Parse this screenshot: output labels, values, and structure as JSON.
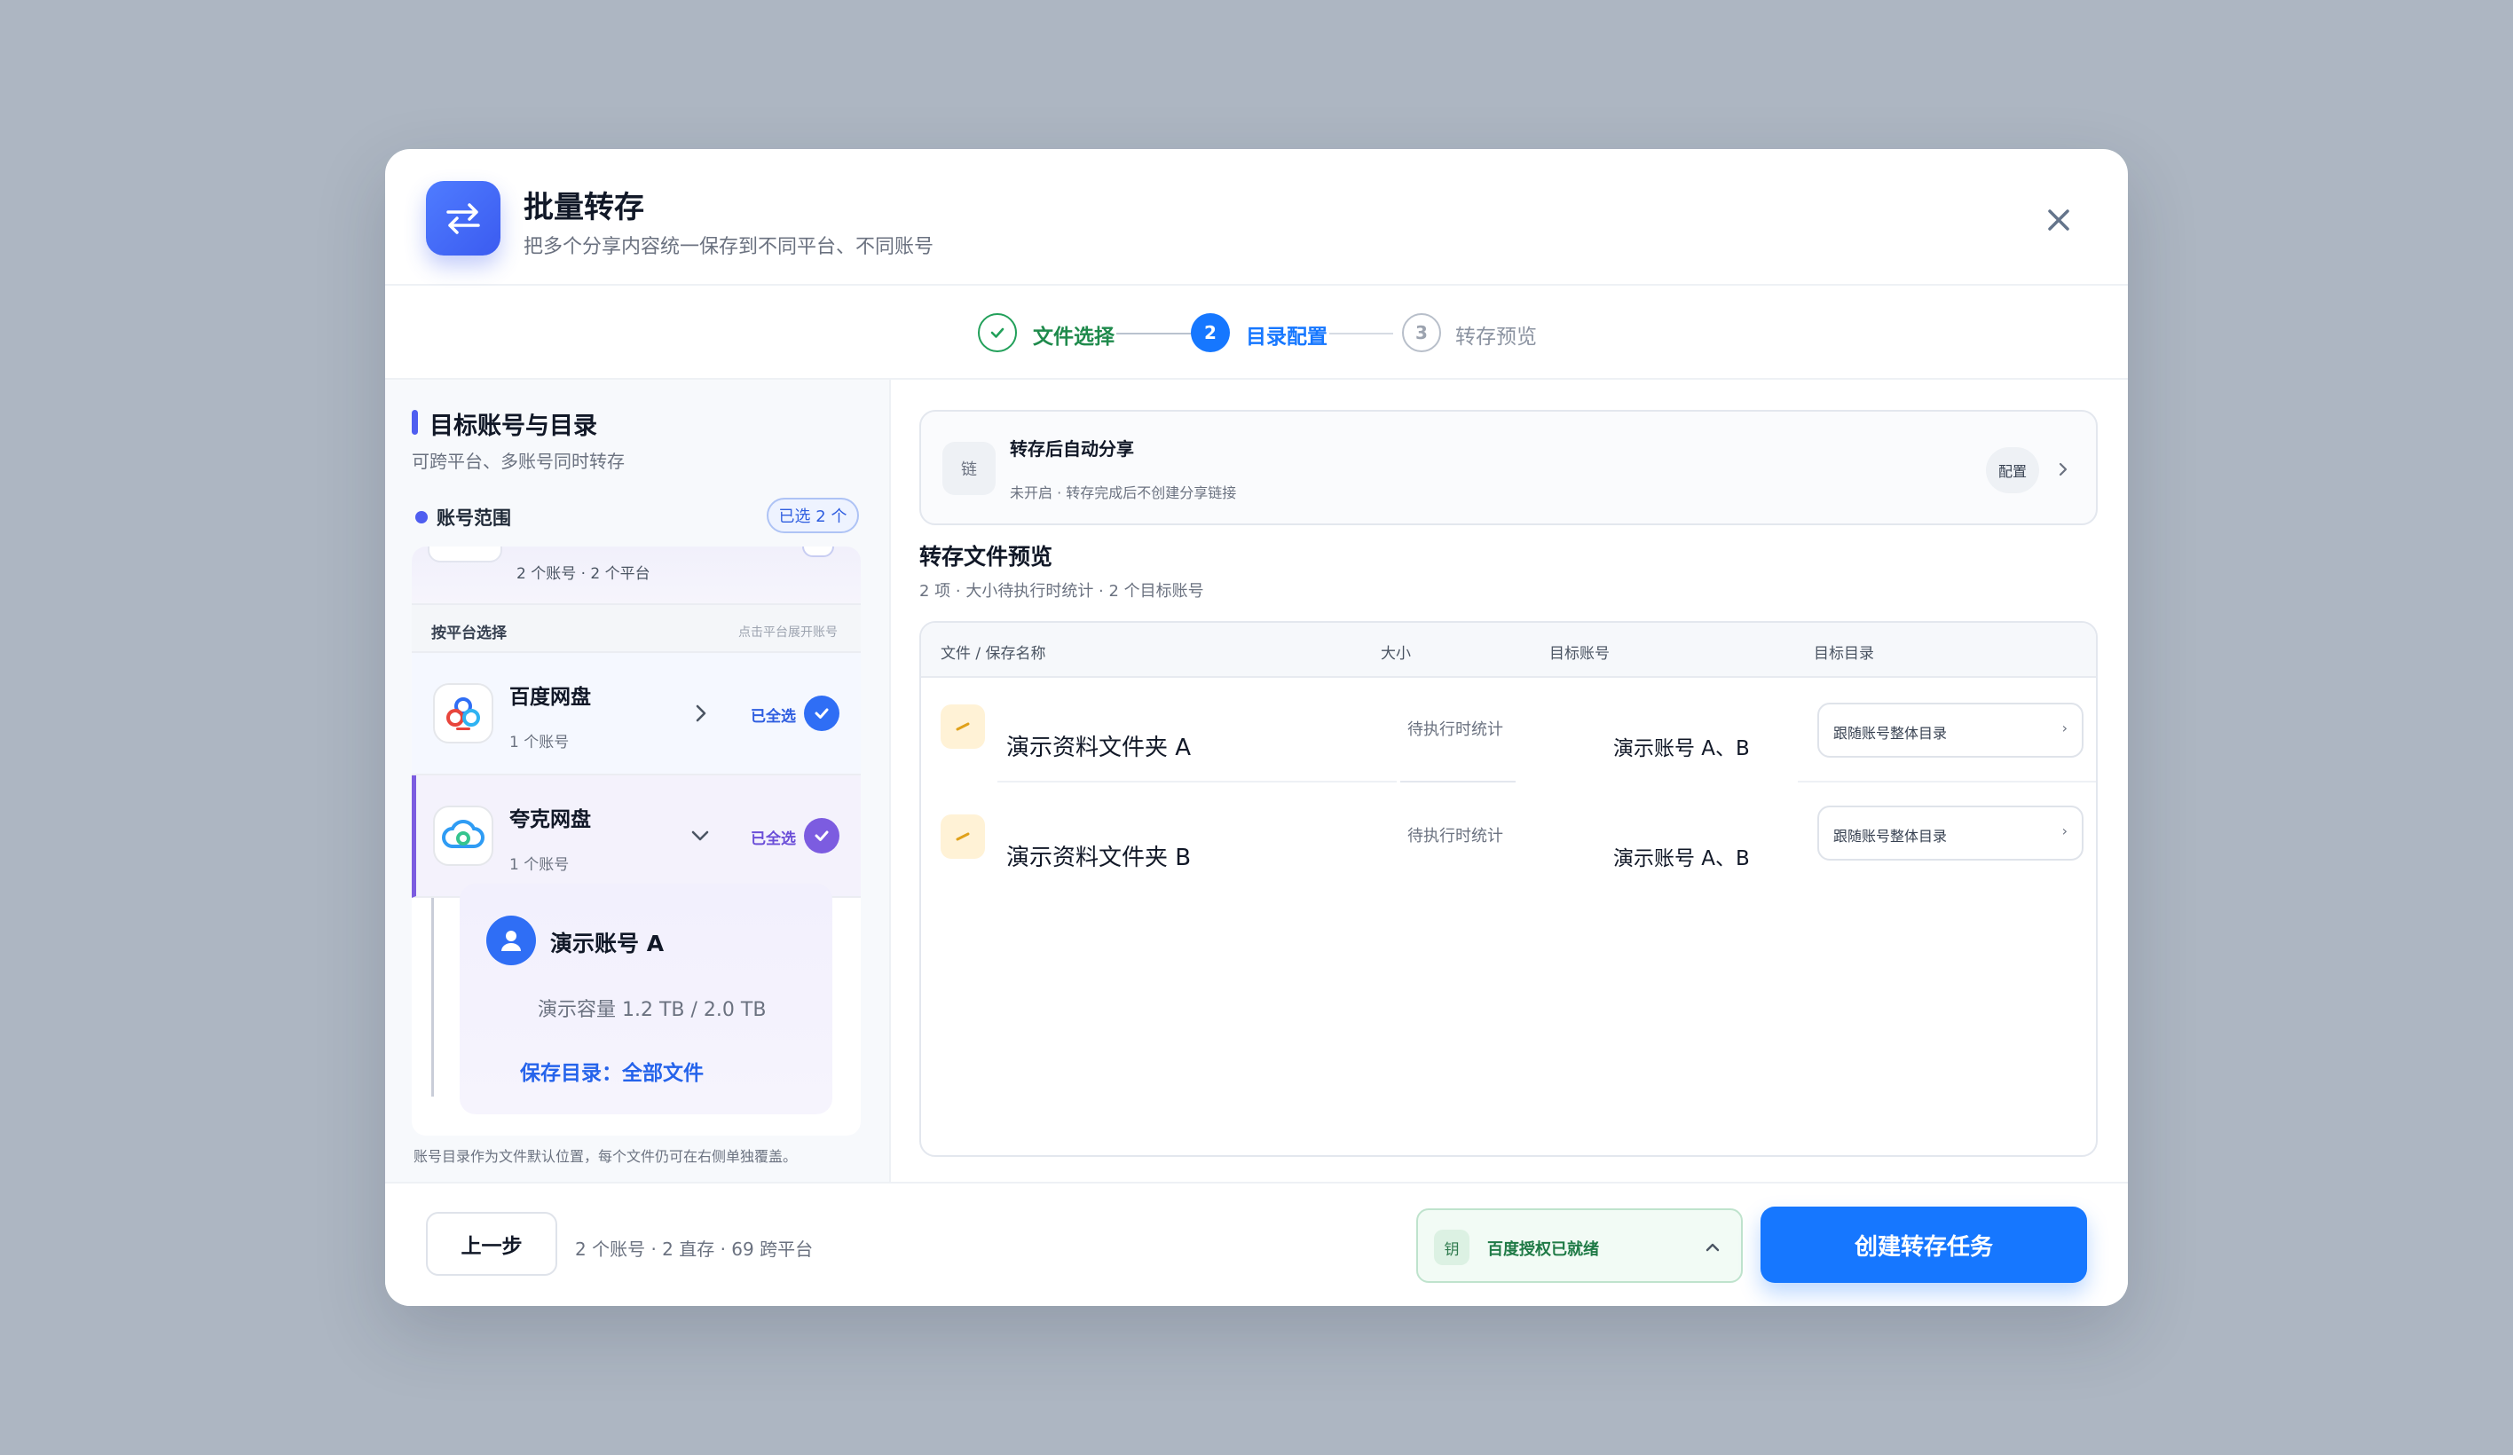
{
  "header": {
    "title": "批量转存",
    "subtitle": "把多个分享内容统一保存到不同平台、不同账号"
  },
  "steps": [
    {
      "num": "✓",
      "label": "文件选择",
      "state": "done"
    },
    {
      "num": "2",
      "label": "目录配置",
      "state": "active"
    },
    {
      "num": "3",
      "label": "转存预览",
      "state": "pending"
    }
  ],
  "left": {
    "title": "目标账号与目录",
    "subtitle": "可跨平台、多账号同时转存",
    "scope_label": "账号范围",
    "selected_badge": "已选 2 个",
    "summary": "2 个账号 · 2 个平台",
    "group_title": "按平台选择",
    "group_hint": "点击平台展开账号",
    "platforms": [
      {
        "name": "百度网盘",
        "count": "1 个账号",
        "status": "已全选",
        "expanded": false
      },
      {
        "name": "夸克网盘",
        "count": "1 个账号",
        "status": "已全选",
        "expanded": true
      }
    ],
    "account": {
      "name": "演示账号 A",
      "capacity": "演示容量 1.2 TB / 2.0 TB",
      "dir": "保存目录：全部文件"
    },
    "footnote": "账号目录作为文件默认位置，每个文件仍可在右侧单独覆盖。"
  },
  "auto_share": {
    "icon_text": "链",
    "title": "转存后自动分享",
    "subtitle": "未开启 · 转存完成后不创建分享链接",
    "config_label": "配置"
  },
  "preview": {
    "title": "转存文件预览",
    "subtitle": "2 项 · 大小待执行时统计 · 2 个目标账号",
    "columns": [
      "文件 / 保存名称",
      "大小",
      "目标账号",
      "目标目录"
    ],
    "rows": [
      {
        "name": "演示资料文件夹 A",
        "size": "待执行时统计",
        "account": "演示账号 A、B",
        "dir": "跟随账号整体目录"
      },
      {
        "name": "演示资料文件夹 B",
        "size": "待执行时统计",
        "account": "演示账号 A、B",
        "dir": "跟随账号整体目录"
      }
    ]
  },
  "footer": {
    "back_label": "上一步",
    "stats": "2 个账号 · 2 直存 · 69 跨平台",
    "auth_icon_text": "钥",
    "auth_label": "百度授权已就绪",
    "create_label": "创建转存任务"
  },
  "colors": {
    "primary": "#1677ff",
    "accent_purple": "#6b4fd8",
    "success": "#1f7a46",
    "backdrop": "#adb6c2"
  }
}
